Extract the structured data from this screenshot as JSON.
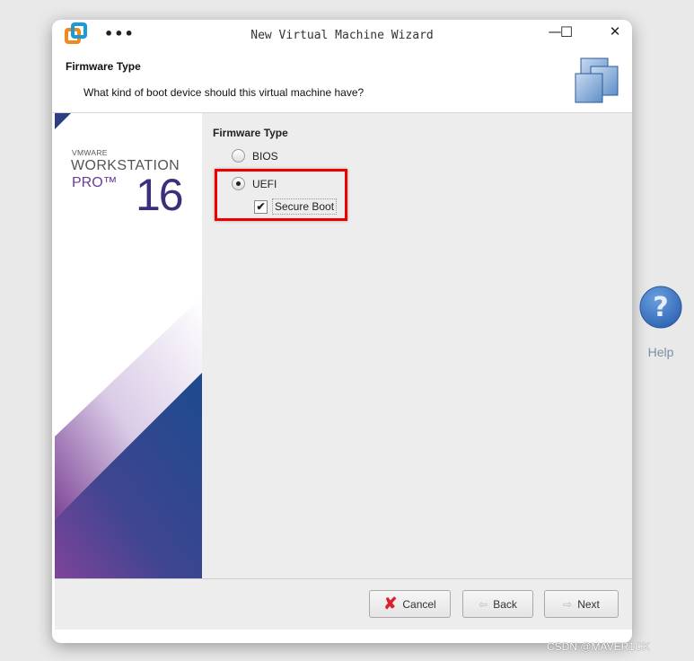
{
  "window": {
    "title": "New Virtual Machine Wizard",
    "menu_label": "•••",
    "minimize": "—",
    "maximize": "☐",
    "close": "✕"
  },
  "header": {
    "title": "Firmware Type",
    "subtitle": "What kind of boot device should this virtual machine have?"
  },
  "brand": {
    "vendor": "VMWARE",
    "product": "WORKSTATION",
    "edition": "PRO™",
    "version": "16"
  },
  "content": {
    "title": "Firmware Type",
    "options": [
      {
        "label": "BIOS",
        "selected": false
      },
      {
        "label": "UEFI",
        "selected": true
      }
    ],
    "secure_boot": {
      "label": "Secure Boot",
      "checked": true
    }
  },
  "footer": {
    "cancel": "Cancel",
    "back": "Back",
    "next": "Next"
  },
  "help": {
    "label": "Help"
  },
  "watermark": "CSDN @MAVER1CK",
  "colors": {
    "highlight": "#e00000",
    "brand_blue": "#23478c",
    "brand_purple": "#7b3f98"
  }
}
